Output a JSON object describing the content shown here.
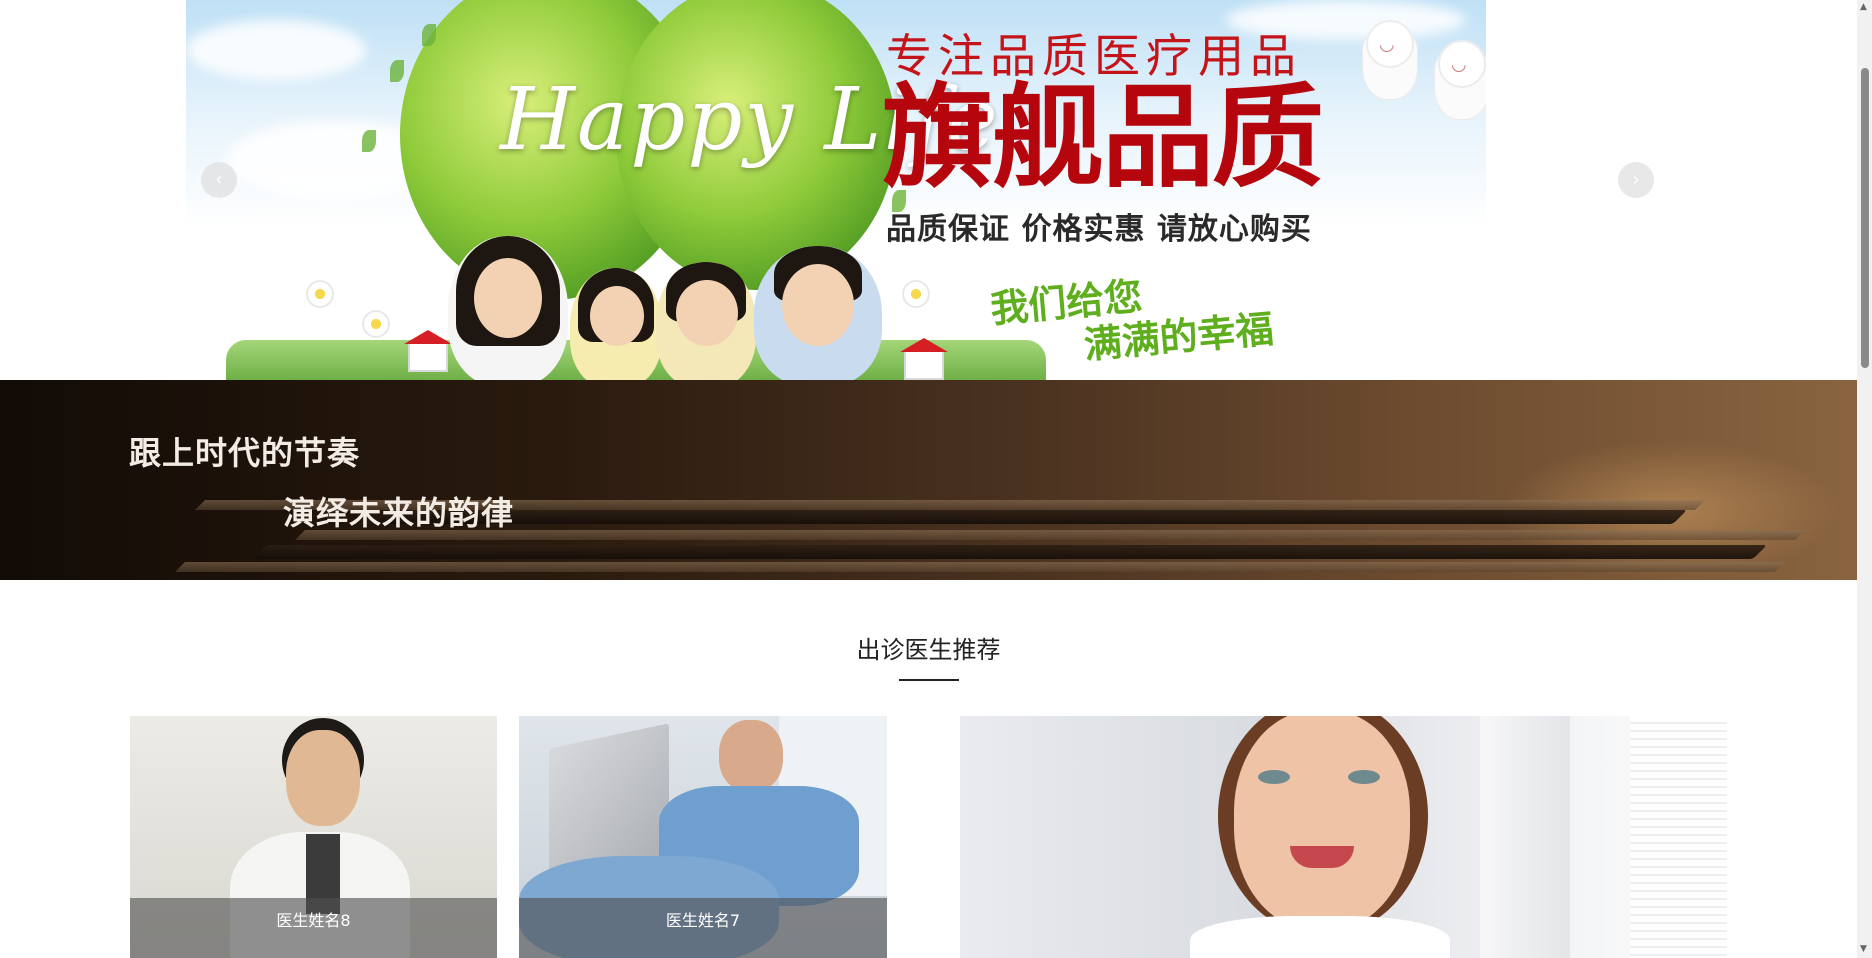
{
  "hero": {
    "tagline": "专注品质医疗用品",
    "headline": "旗舰品质",
    "subline": "品质保证  价格实惠  请放心购买",
    "happy_text": "Happy Life",
    "slogan_line1": "我们给您",
    "slogan_line2": "满满的幸福",
    "prev_icon": "‹",
    "next_icon": "›"
  },
  "banner": {
    "line1": "跟上时代的节奏",
    "line2": "演绎未来的韵律"
  },
  "section": {
    "title": "出诊医生推荐"
  },
  "doctors": [
    {
      "name": "医生姓名8"
    },
    {
      "name": "医生姓名7"
    },
    {
      "name": ""
    }
  ],
  "colors": {
    "headline_red": "#b5060d",
    "slogan_green": "#5fae1e",
    "caption_overlay": "rgba(80,80,80,.62)"
  }
}
